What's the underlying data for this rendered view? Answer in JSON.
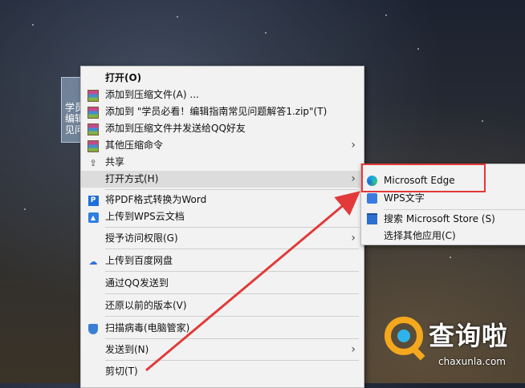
{
  "desktop_icon": {
    "label": "学员\n编辑\n见问"
  },
  "context_menu": {
    "items": [
      {
        "label": "打开(O)"
      },
      {
        "label": "添加到压缩文件(A) ..."
      },
      {
        "label": "添加到 \"学员必看！编辑指南常见问题解答1.zip\"(T)"
      },
      {
        "label": "添加到压缩文件并发送给QQ好友"
      },
      {
        "label": "其他压缩命令"
      },
      {
        "label": "共享"
      },
      {
        "label": "打开方式(H)"
      },
      {
        "label": "将PDF格式转换为Word"
      },
      {
        "label": "上传到WPS云文档"
      },
      {
        "label": "授予访问权限(G)"
      },
      {
        "label": "上传到百度网盘"
      },
      {
        "label": "通过QQ发送到"
      },
      {
        "label": "还原以前的版本(V)"
      },
      {
        "label": "扫描病毒(电脑管家)"
      },
      {
        "label": "发送到(N)"
      },
      {
        "label": "剪切(T)"
      }
    ]
  },
  "submenu": {
    "items": [
      {
        "label": "Microsoft Edge"
      },
      {
        "label": "WPS文字"
      },
      {
        "label": "搜索 Microsoft Store (S)"
      },
      {
        "label": "选择其他应用(C)"
      }
    ]
  },
  "watermark": {
    "title": "查询啦",
    "subtitle": "chaxunla.com"
  },
  "colors": {
    "highlight_box": "#e23a3a",
    "arrow": "#e23a3a",
    "menu_bg": "#f2f2f2",
    "hover_bg": "#dcdcdc"
  }
}
